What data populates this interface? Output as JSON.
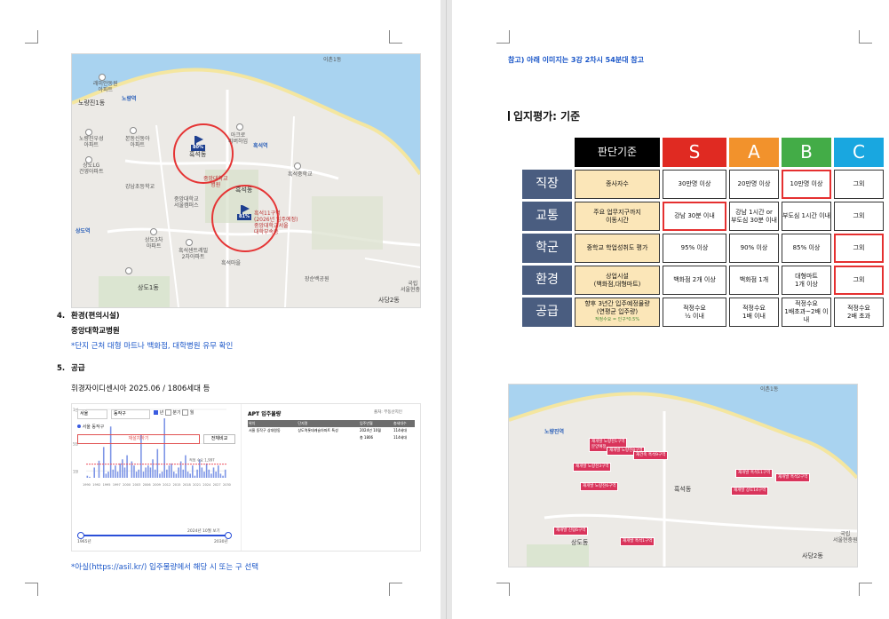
{
  "left_page": {
    "map1": {
      "labels": {
        "ichon": "이촌1동",
        "noryangjin": "노량진1동",
        "raemian_top": "래미안동원\n아파트",
        "noryangjin_stn": "노량역",
        "nodeul": "노들역",
        "noryangjin_woosung": "노량진우성\n아파트",
        "bonsan": "본동신동아\n아파트",
        "sangdo_lg": "상도LG\n건영아파트",
        "acro": "아크로\n리버하임",
        "heukseok_stn": "흑석역",
        "gangnam_elem": "강남초등학교",
        "cau_hospital": "중앙대학교\n병원",
        "heukseok_dong": "흑석동",
        "cau_seoul": "중앙대학교\n서울캠퍼스",
        "heukseok_hs": "흑석고등학교",
        "heukseok_jung": "흑석중학교",
        "sangdo_stn": "상도역",
        "sangdo_3": "상도3차\n아파트",
        "sangdo_1": "상도1동",
        "sangdo_dong": "상도동",
        "heukseok_center": "흑석센트레빌\n2차아파트",
        "heukseok_ma": "흑석마을",
        "sadang": "사당2동",
        "seoul_cem": "국립\n서울현충원",
        "park": "장순백공원"
      },
      "flags": [
        {
          "tag": "80%",
          "label": "흑석동"
        },
        {
          "tag": "81%",
          "label": "흑석11구역\n(2026년 입주예정)\n중앙대학교서울\n대학부속중"
        }
      ]
    },
    "items": [
      {
        "num": "4.",
        "title": "환경(편의시설)"
      },
      {
        "num": "5.",
        "title": "공급"
      }
    ],
    "env_text": "중앙대학교병원",
    "env_note": "*단지 근처 대형 마트나 백화점, 대학병원 유무 확인",
    "supply_text": "휘경자이디센시아 2025.06 / 1806세대 등",
    "screenshot": {
      "filter_sido": "서울",
      "filter_gu": "동작구",
      "filters": [
        "년",
        "분기",
        "월"
      ],
      "legend": "서울 동작구",
      "button": "재설치하기",
      "compare": "전체비교",
      "chart_note": "적정 수요 1,997",
      "period": "2024년 10월 보기",
      "range_from": "1965년",
      "range_to": "2030년",
      "right_title": "APT 입주물량",
      "right_source": "출처: 부동산지인",
      "table_headers": [
        "위치",
        "단지명",
        "입주년월",
        "총세대수"
      ],
      "table_rows": [
        [
          "서울 동작구 상대원동",
          "상도역롯데캐슬아파트 특성",
          "2024년 10월",
          "114세대"
        ],
        [
          "",
          "",
          "총 1806",
          "114세대"
        ]
      ]
    },
    "bar_chart": {
      "type": "bar",
      "title": "",
      "ylabel": "",
      "note": "적정 수요 1,997",
      "x_ticks": [
        "1990",
        "1992",
        "1995",
        "1997",
        "2000",
        "2003",
        "2006",
        "2009",
        "2012",
        "2015",
        "2018",
        "2021",
        "2024",
        "2027",
        "2030"
      ],
      "y_ticks": [
        "1만",
        "5천",
        "1천"
      ],
      "values": [
        300,
        150,
        0,
        1500,
        0,
        2500,
        0,
        4500,
        600,
        900,
        7500,
        1200,
        1800,
        900,
        2100,
        2700,
        1500,
        3300,
        0,
        2400,
        1800,
        900,
        1200,
        6300,
        900,
        1500,
        1800,
        1500,
        2700,
        1200,
        4200,
        600,
        900,
        8700,
        1200,
        1800,
        2100,
        900,
        600,
        1500,
        2400,
        1200,
        3300,
        900,
        600,
        1800,
        300,
        1200,
        2700,
        1500,
        900,
        2100,
        1200,
        600,
        1500,
        900,
        1800,
        600,
        300,
        1200
      ],
      "threshold": 1997
    },
    "asil_note": "*아실(https://asil.kr/) 입주물량에서 해당 시 또는 구 선택"
  },
  "right_page": {
    "ref_note": "참고) 아래 이미지는 3강 2차시 54분대 참고",
    "heading": "입지평가: 기준",
    "table": {
      "corner": "판단기준",
      "grades": [
        {
          "label": "S",
          "color": "#e02a22"
        },
        {
          "label": "A",
          "color": "#f2922c"
        },
        {
          "label": "B",
          "color": "#43ac47"
        },
        {
          "label": "C",
          "color": "#19a7e0"
        }
      ],
      "rows": [
        {
          "head": "직장",
          "crit": "종사자수",
          "cells": [
            "30만명 이상",
            "20만명 이상",
            "10만명 이상",
            "그외"
          ],
          "hl": [
            false,
            false,
            true,
            false
          ]
        },
        {
          "head": "교통",
          "crit": "주요 업무지구까지\n이동시간",
          "cells": [
            "강남 30분 이내",
            "강남 1시간 or\n부도심 30분 이내",
            "부도심 1시간 이내",
            "그외"
          ],
          "hl": [
            true,
            false,
            false,
            false
          ]
        },
        {
          "head": "학군",
          "crit": "중학교 학업성취도 평가",
          "cells": [
            "95% 이상",
            "90% 이상",
            "85% 이상",
            "그외"
          ],
          "hl": [
            false,
            false,
            false,
            true
          ]
        },
        {
          "head": "환경",
          "crit": "상업시설\n(백화점,대형마트)",
          "cells": [
            "백화점 2개 이상",
            "백화점 1개",
            "대형마트\n1개 이상",
            "그외"
          ],
          "hl": [
            false,
            false,
            false,
            true
          ]
        },
        {
          "head": "공급",
          "crit": "향후 3년간 입주예정물량\n(연평균 입주량)",
          "crit_sub": "적정수요 = 인구*0.5%",
          "cells": [
            "적정수요\n½ 이내",
            "적정수요\n1배 이내",
            "적정수요\n1배초과~2배 이내",
            "적정수요\n2배 초과"
          ],
          "hl": [
            false,
            false,
            false,
            false
          ]
        }
      ]
    },
    "map2": {
      "labels": {
        "ichon": "이촌1동",
        "heukseok": "흑석동",
        "sadang": "사당2동",
        "cem": "국립\n서울현충원",
        "noryangjin": "노량진역",
        "sangdo": "상도동"
      },
      "pins": [
        "재개발 노량진1구역\n분양예정",
        "재개발 노량진3구역",
        "재개발 노량진6구역",
        "재개발 노량진8구역",
        "재건축 흑석9구역",
        "재개발 흑석11구역",
        "재개발 흑석2구역",
        "재개발 상도14구역",
        "재개발 신림6구역",
        "재개발 흑석1구역"
      ]
    }
  }
}
